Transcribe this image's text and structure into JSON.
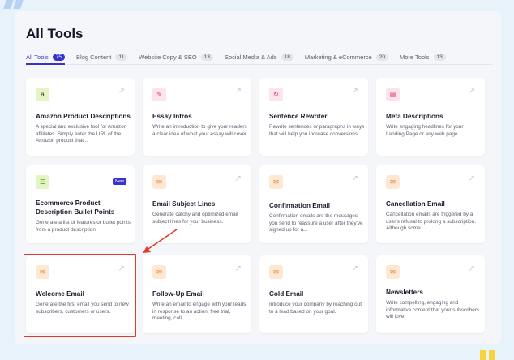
{
  "page": {
    "title": "All Tools"
  },
  "tabs": [
    {
      "label": "All Tools",
      "count": "75"
    },
    {
      "label": "Blog Content",
      "count": "11"
    },
    {
      "label": "Website Copy & SEO",
      "count": "13"
    },
    {
      "label": "Social Media & Ads",
      "count": "18"
    },
    {
      "label": "Marketing & eCommerce",
      "count": "20"
    },
    {
      "label": "More Tools",
      "count": "13"
    }
  ],
  "cards": [
    {
      "title": "Amazon Product Descriptions",
      "desc": "A special and exclusive tool for Amazon affiliates. Simply enter the URL of the Amazon product that...",
      "icon": "amazon-icon",
      "glyph": "a"
    },
    {
      "title": "Essay Intros",
      "desc": "Write an introduction to give your readers a clear idea of what your essay will cover.",
      "icon": "pencil-icon",
      "glyph": "✎"
    },
    {
      "title": "Sentence Rewriter",
      "desc": "Rewrite sentences or paragraphs in ways that will help you increase conversions.",
      "icon": "refresh-icon",
      "glyph": "↻"
    },
    {
      "title": "Meta Descriptions",
      "desc": "Write engaging headlines for your Landing Page or any web page.",
      "icon": "document-icon",
      "glyph": "▤"
    },
    {
      "title": "Ecommerce Product Description Bullet Points",
      "desc": "Generate a list of features or bullet points from a product description.",
      "icon": "list-icon",
      "glyph": "☰",
      "badge": "New"
    },
    {
      "title": "Email Subject Lines",
      "desc": "Generate catchy and optimized email subject lines for your business.",
      "icon": "mail-icon",
      "glyph": "✉"
    },
    {
      "title": "Confirmation Email",
      "desc": "Confirmation emails are the messages you send to reassure a user after they've signed up for a...",
      "icon": "mail-check-icon",
      "glyph": "✉"
    },
    {
      "title": "Cancellation Email",
      "desc": "Cancellation emails are triggered by a user's refusal to prolong a subscription. Although some...",
      "icon": "mail-cancel-icon",
      "glyph": "✉"
    },
    {
      "title": "Welcome Email",
      "desc": "Generate the first email you send to new subscribers, customers or users.",
      "icon": "mail-welcome-icon",
      "glyph": "✉"
    },
    {
      "title": "Follow-Up Email",
      "desc": "Write an email to engage with your leads in response to an action: free trial, meeting, call....",
      "icon": "mail-followup-icon",
      "glyph": "✉"
    },
    {
      "title": "Cold Email",
      "desc": "Introduce your company by reaching out to a lead based on your goal.",
      "icon": "mail-cold-icon",
      "glyph": "✉"
    },
    {
      "title": "Newsletters",
      "desc": "Write compelling, engaging and informative content that your subscribers will love.",
      "icon": "newsletter-icon",
      "glyph": "✉"
    }
  ],
  "colors": {
    "accent": "#3a33c8",
    "highlight": "#e03a2e",
    "background": "#e8f2fb"
  }
}
